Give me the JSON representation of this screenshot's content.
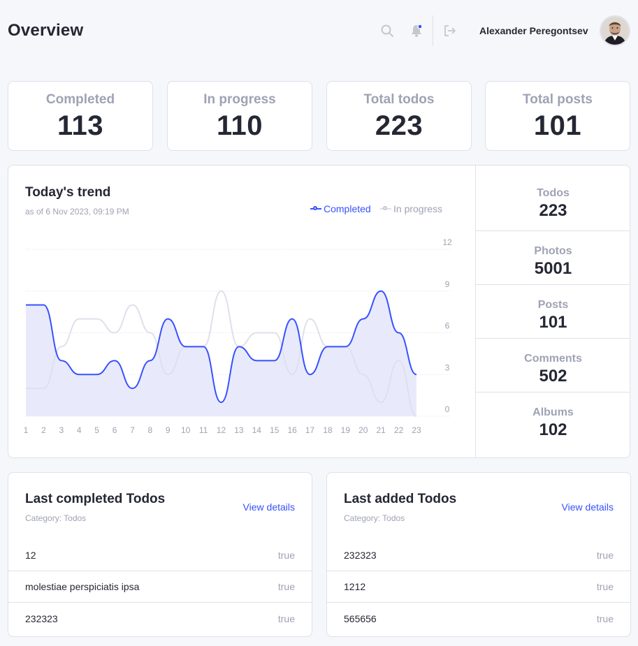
{
  "header": {
    "title": "Overview",
    "user_name": "Alexander Peregontsev",
    "icons": [
      "search-icon",
      "bell-icon",
      "logout-icon"
    ],
    "notification_dot": true
  },
  "stats": [
    {
      "label": "Completed",
      "value": "113"
    },
    {
      "label": "In progress",
      "value": "110"
    },
    {
      "label": "Total todos",
      "value": "223"
    },
    {
      "label": "Total posts",
      "value": "101"
    }
  ],
  "trend": {
    "title": "Today's trend",
    "subtitle": "as of 6 Nov 2023, 09:19 PM",
    "legend": {
      "completed": "Completed",
      "in_progress": "In progress"
    },
    "side": [
      {
        "label": "Todos",
        "value": "223"
      },
      {
        "label": "Photos",
        "value": "5001"
      },
      {
        "label": "Posts",
        "value": "101"
      },
      {
        "label": "Comments",
        "value": "502"
      },
      {
        "label": "Albums",
        "value": "102"
      }
    ]
  },
  "chart_data": {
    "type": "area",
    "x": [
      1,
      2,
      3,
      4,
      5,
      6,
      7,
      8,
      9,
      10,
      11,
      12,
      13,
      14,
      15,
      16,
      17,
      18,
      19,
      20,
      21,
      22,
      23
    ],
    "series": [
      {
        "name": "Completed",
        "values": [
          8,
          8,
          4,
          3,
          3,
          4,
          2,
          4,
          7,
          5,
          5,
          1,
          5,
          4,
          4,
          7,
          3,
          5,
          5,
          7,
          9,
          6,
          3
        ],
        "color": "#3751ff"
      },
      {
        "name": "In progress",
        "values": [
          2,
          2,
          5,
          7,
          7,
          6,
          8,
          6,
          3,
          5,
          5,
          9,
          5,
          6,
          6,
          3,
          7,
          5,
          5,
          3,
          1,
          4,
          0
        ],
        "color": "#dfe0eb"
      }
    ],
    "yticks": [
      0,
      3,
      6,
      9,
      12
    ],
    "ylim": [
      0,
      12
    ],
    "grid": "horizontal dotted",
    "y_axis_position": "right",
    "legend_position": "top-right"
  },
  "lists": [
    {
      "title": "Last completed Todos",
      "subtitle": "Category: Todos",
      "link": "View details",
      "rows": [
        {
          "text": "12",
          "status": "true"
        },
        {
          "text": "molestiae perspiciatis ipsa",
          "status": "true"
        },
        {
          "text": "232323",
          "status": "true"
        }
      ]
    },
    {
      "title": "Last added Todos",
      "subtitle": "Category: Todos",
      "link": "View details",
      "rows": [
        {
          "text": "232323",
          "status": "true"
        },
        {
          "text": "1212",
          "status": "true"
        },
        {
          "text": "565656",
          "status": "true"
        }
      ]
    }
  ],
  "colors": {
    "accent": "#3751ff",
    "muted": "#9fa2b4",
    "border": "#dfe0eb",
    "background": "#f6f7fb",
    "area_fill": "#e8eafc"
  }
}
